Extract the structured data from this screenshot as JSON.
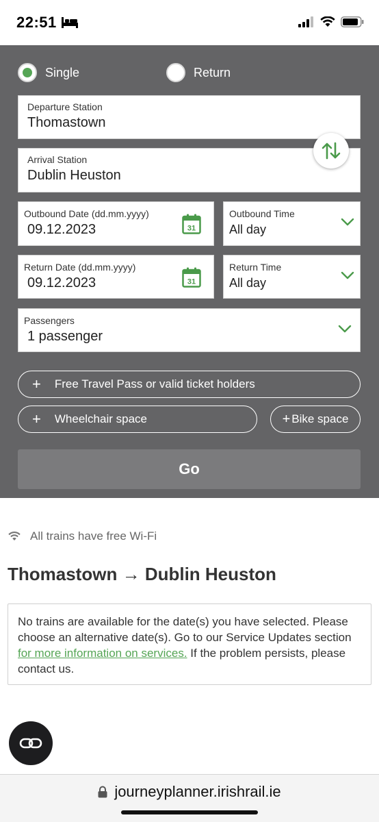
{
  "status": {
    "time": "22:51"
  },
  "trip_type": {
    "single_label": "Single",
    "return_label": "Return",
    "selected": "single"
  },
  "departure": {
    "label": "Departure Station",
    "value": "Thomastown"
  },
  "arrival": {
    "label": "Arrival Station",
    "value": "Dublin Heuston"
  },
  "outbound_date": {
    "label": "Outbound Date (dd.mm.yyyy)",
    "value": "09.12.2023",
    "calendar_day": "31"
  },
  "outbound_time": {
    "label": "Outbound Time",
    "value": "All day"
  },
  "return_date": {
    "label": "Return Date (dd.mm.yyyy)",
    "value": "09.12.2023",
    "calendar_day": "31"
  },
  "return_time": {
    "label": "Return Time",
    "value": "All day"
  },
  "passengers": {
    "label": "Passengers",
    "value": "1 passenger"
  },
  "options": {
    "free_travel_label": "Free Travel Pass or valid ticket holders",
    "wheelchair_label": "Wheelchair space",
    "bike_label": "Bike space",
    "plus": "+"
  },
  "go_button": {
    "label": "Go"
  },
  "wifi_note": "All trains have free Wi-Fi",
  "route": {
    "from": "Thomastown",
    "arrow": "→",
    "to": "Dublin Heuston"
  },
  "notice": {
    "text_before": "No trains are available for the date(s) you have selected. Please choose an alternative date(s). Go to our Service Updates section ",
    "link_text": "for more information on services.",
    "text_after": " If the problem persists, please contact us."
  },
  "url_bar": {
    "domain": "journeyplanner.irishrail.ie"
  },
  "colors": {
    "panel": "#646466",
    "accent_green": "#55a555",
    "go_button": "#7b7b7d"
  }
}
